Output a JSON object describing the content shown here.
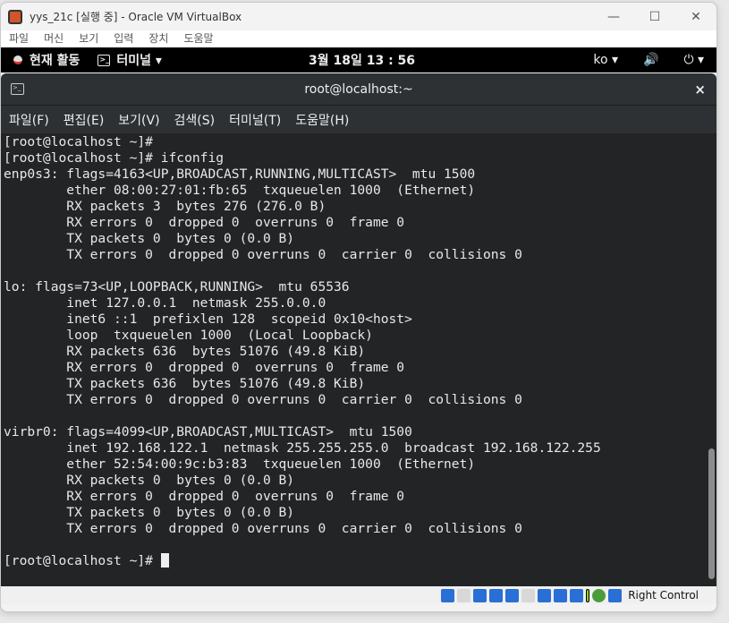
{
  "window": {
    "title": "yys_21c [실행 중] - Oracle VM VirtualBox",
    "controls": [
      "—",
      "☐",
      "✕"
    ]
  },
  "vm_menu": [
    "파일",
    "머신",
    "보기",
    "입력",
    "장치",
    "도움말"
  ],
  "gnome_bar": {
    "activities": "현재 활동",
    "app": "터미널 ▾",
    "clock": "3월 18일  13 : 56",
    "lang": "ko ▾",
    "volume": "🔊",
    "power": "⏻ ▾"
  },
  "terminal": {
    "title": "root@localhost:~",
    "close": "×",
    "menu": [
      "파일(F)",
      "편집(E)",
      "보기(V)",
      "검색(S)",
      "터미널(T)",
      "도움말(H)"
    ],
    "lines": [
      "[root@localhost ~]#",
      "[root@localhost ~]# ifconfig",
      "enp0s3: flags=4163<UP,BROADCAST,RUNNING,MULTICAST>  mtu 1500",
      "        ether 08:00:27:01:fb:65  txqueuelen 1000  (Ethernet)",
      "        RX packets 3  bytes 276 (276.0 B)",
      "        RX errors 0  dropped 0  overruns 0  frame 0",
      "        TX packets 0  bytes 0 (0.0 B)",
      "        TX errors 0  dropped 0 overruns 0  carrier 0  collisions 0",
      "",
      "lo: flags=73<UP,LOOPBACK,RUNNING>  mtu 65536",
      "        inet 127.0.0.1  netmask 255.0.0.0",
      "        inet6 ::1  prefixlen 128  scopeid 0x10<host>",
      "        loop  txqueuelen 1000  (Local Loopback)",
      "        RX packets 636  bytes 51076 (49.8 KiB)",
      "        RX errors 0  dropped 0  overruns 0  frame 0",
      "        TX packets 636  bytes 51076 (49.8 KiB)",
      "        TX errors 0  dropped 0 overruns 0  carrier 0  collisions 0",
      "",
      "virbr0: flags=4099<UP,BROADCAST,MULTICAST>  mtu 1500",
      "        inet 192.168.122.1  netmask 255.255.255.0  broadcast 192.168.122.255",
      "        ether 52:54:00:9c:b3:83  txqueuelen 1000  (Ethernet)",
      "        RX packets 0  bytes 0 (0.0 B)",
      "        RX errors 0  dropped 0  overruns 0  frame 0",
      "        TX packets 0  bytes 0 (0.0 B)",
      "        TX errors 0  dropped 0 overruns 0  carrier 0  collisions 0",
      ""
    ],
    "prompt": "[root@localhost ~]# "
  },
  "status_bar": {
    "host_key": "Right Control"
  }
}
